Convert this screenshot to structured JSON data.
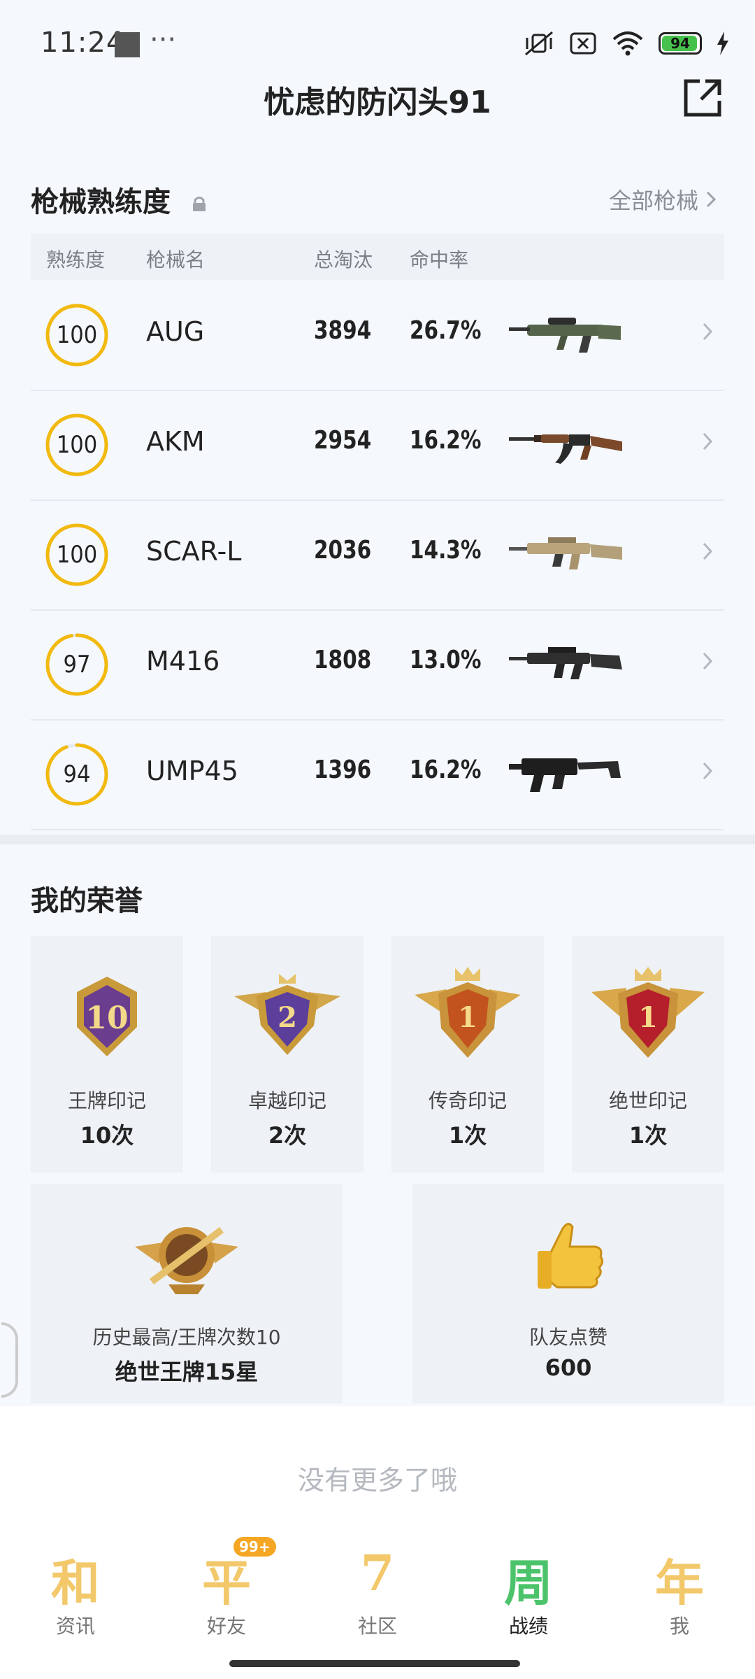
{
  "status_bar": {
    "time": "11:24",
    "battery": "94"
  },
  "header": {
    "title": "忧虑的防闪头91"
  },
  "weapons": {
    "title": "枪械熟练度",
    "all_link": "全部枪械",
    "columns": [
      "熟练度",
      "枪械名",
      "总淘汰",
      "命中率"
    ],
    "rows": [
      {
        "mastery": "100",
        "name": "AUG",
        "kills": "3894",
        "accuracy": "26.7%",
        "progress": 100,
        "gun": "aug"
      },
      {
        "mastery": "100",
        "name": "AKM",
        "kills": "2954",
        "accuracy": "16.2%",
        "progress": 100,
        "gun": "akm"
      },
      {
        "mastery": "100",
        "name": "SCAR-L",
        "kills": "2036",
        "accuracy": "14.3%",
        "progress": 100,
        "gun": "scar"
      },
      {
        "mastery": "97",
        "name": "M416",
        "kills": "1808",
        "accuracy": "13.0%",
        "progress": 97,
        "gun": "m416"
      },
      {
        "mastery": "94",
        "name": "UMP45",
        "kills": "1396",
        "accuracy": "16.2%",
        "progress": 94,
        "gun": "ump"
      }
    ]
  },
  "honors": {
    "title": "我的荣誉",
    "cards": [
      {
        "label": "王牌印记",
        "value": "10次",
        "medal_text": "10",
        "medal": "ace-seal-icon"
      },
      {
        "label": "卓越印记",
        "value": "2次",
        "medal_text": "2",
        "medal": "excellence-seal-icon"
      },
      {
        "label": "传奇印记",
        "value": "1次",
        "medal_text": "1",
        "medal": "legend-seal-icon"
      },
      {
        "label": "绝世印记",
        "value": "1次",
        "medal_text": "1",
        "medal": "peerless-seal-icon"
      }
    ],
    "wide_cards": [
      {
        "label": "历史最高/王牌次数10",
        "value": "绝世王牌15星",
        "medal": "peerless-ace-rank-icon"
      },
      {
        "label": "队友点赞",
        "value": "600",
        "medal": "thumbs-up-icon"
      }
    ]
  },
  "footer": {
    "no_more": "没有更多了哦"
  },
  "nav": {
    "items": [
      {
        "glyph": "和",
        "label": "资讯"
      },
      {
        "glyph": "平",
        "label": "好友",
        "badge": "99+"
      },
      {
        "glyph": "7",
        "label": "社区"
      },
      {
        "glyph": "周",
        "label": "战绩"
      },
      {
        "glyph": "年",
        "label": "我"
      }
    ],
    "active_index": 3
  },
  "colors": {
    "accent_ring": "#f2b90f",
    "ring_track": "#e8ebf0",
    "active_nav": "#4cc36a"
  }
}
